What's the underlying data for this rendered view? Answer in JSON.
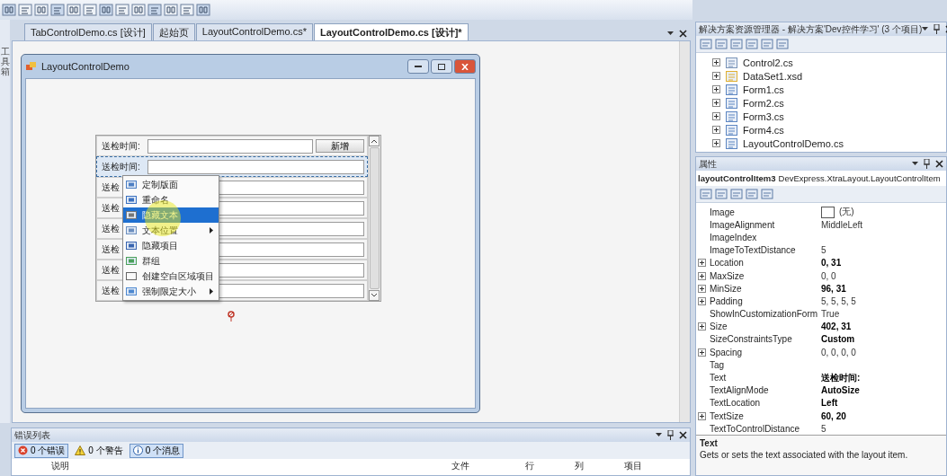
{
  "toolbox": {
    "label": "工具箱"
  },
  "document_tabs": [
    {
      "label": "TabControlDemo.cs [设计]",
      "selected": false
    },
    {
      "label": "起始页",
      "selected": false
    },
    {
      "label": "LayoutControlDemo.cs*",
      "selected": false
    },
    {
      "label": "LayoutControlDemo.cs [设计]*",
      "selected": true
    }
  ],
  "form": {
    "title": "LayoutControlDemo",
    "rows": [
      {
        "label": "送检时间:",
        "button": "新增",
        "selected": false
      },
      {
        "label": "送检时间:",
        "selected": true
      },
      {
        "label": "送检",
        "selected": false
      },
      {
        "label": "送检",
        "selected": false
      },
      {
        "label": "送检",
        "selected": false
      },
      {
        "label": "送检",
        "selected": false
      },
      {
        "label": "送检",
        "selected": false
      },
      {
        "label": "送检",
        "selected": false
      }
    ]
  },
  "context_menu": [
    {
      "label": "定制版面",
      "kind": "customize",
      "selected": false,
      "submenu": false
    },
    {
      "label": "重命名",
      "kind": "rename",
      "selected": false,
      "submenu": false
    },
    {
      "label": "隐藏文本",
      "kind": "hide-text",
      "selected": true,
      "submenu": false
    },
    {
      "label": "文本位置",
      "kind": "text-position",
      "selected": false,
      "submenu": true
    },
    {
      "label": "隐藏项目",
      "kind": "hide-item",
      "selected": false,
      "submenu": false
    },
    {
      "label": "群组",
      "kind": "group",
      "selected": false,
      "submenu": false
    },
    {
      "label": "创建空白区域项目",
      "kind": "empty-space",
      "selected": false,
      "submenu": false
    },
    {
      "label": "强制限定大小",
      "kind": "size",
      "selected": false,
      "submenu": true
    }
  ],
  "error_list": {
    "title": "错误列表",
    "filters": [
      {
        "label": "0 个错误",
        "kind": "error",
        "selected": true
      },
      {
        "label": "0 个警告",
        "kind": "warning",
        "selected": false
      },
      {
        "label": "0 个消息",
        "kind": "info",
        "selected": true
      }
    ],
    "columns": [
      "说明",
      "文件",
      "行",
      "列",
      "项目"
    ]
  },
  "solution_explorer": {
    "title": "解决方案资源管理器 - 解决方案'Dev控件学习' (3 个项目)",
    "items": [
      {
        "label": "Control2.cs",
        "kind": "control",
        "expanded": false
      },
      {
        "label": "DataSet1.xsd",
        "kind": "dataset",
        "expanded": false
      },
      {
        "label": "Form1.cs",
        "kind": "form",
        "expanded": false
      },
      {
        "label": "Form2.cs",
        "kind": "form",
        "expanded": false
      },
      {
        "label": "Form3.cs",
        "kind": "form",
        "expanded": false
      },
      {
        "label": "Form4.cs",
        "kind": "form",
        "expanded": false
      },
      {
        "label": "LayoutControlDemo.cs",
        "kind": "form",
        "expanded": false
      }
    ]
  },
  "properties": {
    "title": "属性",
    "object_name": "layoutControlItem3",
    "object_type": "DevExpress.XtraLayout.LayoutControlItem",
    "rows": [
      {
        "name": "Image",
        "value": "(无)",
        "kind": "image",
        "expandable": false,
        "modified": false
      },
      {
        "name": "ImageAlignment",
        "value": "MiddleLeft",
        "kind": "text",
        "expandable": false,
        "modified": false
      },
      {
        "name": "ImageIndex",
        "kind": "text",
        "expandable": false
      },
      {
        "name": "ImageToTextDistance",
        "value": "5",
        "kind": "text",
        "expandable": false,
        "modified": false
      },
      {
        "name": "Location",
        "value": "0, 31",
        "kind": "text",
        "expandable": true,
        "modified": true
      },
      {
        "name": "MaxSize",
        "value": "0, 0",
        "kind": "text",
        "expandable": true,
        "modified": false
      },
      {
        "name": "MinSize",
        "value": "96, 31",
        "kind": "text",
        "expandable": true,
        "modified": true
      },
      {
        "name": "Padding",
        "value": "5, 5, 5, 5",
        "kind": "text",
        "expandable": true,
        "modified": false
      },
      {
        "name": "ShowInCustomizationForm",
        "value": "True",
        "kind": "text",
        "expandable": false,
        "modified": false
      },
      {
        "name": "Size",
        "value": "402, 31",
        "kind": "text",
        "expandable": true,
        "modified": true
      },
      {
        "name": "SizeConstraintsType",
        "value": "Custom",
        "kind": "text",
        "expandable": false,
        "modified": true
      },
      {
        "name": "Spacing",
        "value": "0, 0, 0, 0",
        "kind": "text",
        "expandable": true,
        "modified": false
      },
      {
        "name": "Tag",
        "kind": "text",
        "expandable": false
      },
      {
        "name": "Text",
        "value": "送检时间:",
        "kind": "text",
        "expandable": false,
        "modified": true
      },
      {
        "name": "TextAlignMode",
        "value": "AutoSize",
        "kind": "text",
        "expandable": false,
        "modified": true
      },
      {
        "name": "TextLocation",
        "value": "Left",
        "kind": "text",
        "expandable": false,
        "modified": true
      },
      {
        "name": "TextSize",
        "value": "60, 20",
        "kind": "text",
        "expandable": true,
        "modified": true
      },
      {
        "name": "TextToControlDistance",
        "value": "5",
        "kind": "text",
        "expandable": false,
        "modified": false
      }
    ],
    "description_title": "Text",
    "description": "Gets or sets the text associated with the layout item."
  }
}
